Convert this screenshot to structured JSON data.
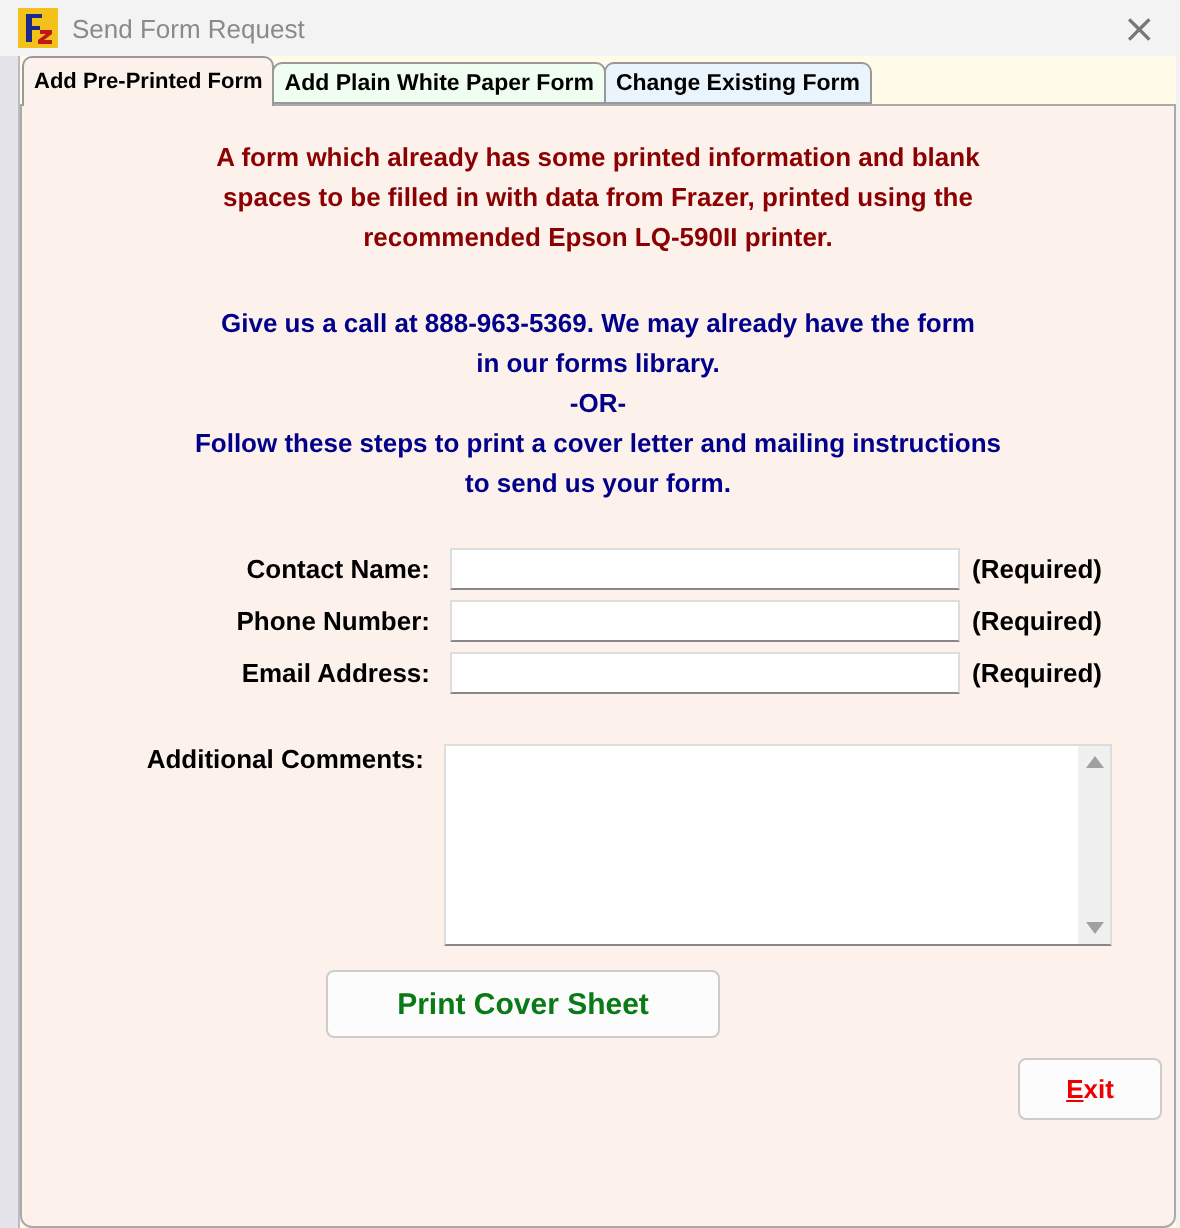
{
  "window": {
    "title": "Send Form Request",
    "close": "×"
  },
  "tabs": [
    {
      "label": "Add Pre-Printed Form",
      "selected": true,
      "color": "#fdf1ec"
    },
    {
      "label": "Add Plain White Paper Form",
      "selected": false,
      "color": "#effef0"
    },
    {
      "label": "Change Existing Form",
      "selected": false,
      "color": "#eaf4fd"
    }
  ],
  "description": [
    "A form which already has some printed information and blank",
    "spaces to be filled in with data from Frazer, printed using the",
    "recommended Epson LQ-590II printer."
  ],
  "instructions": [
    "Give us a call at 888-963-5369. We may already have the form",
    "in our forms library.",
    "-OR-",
    "Follow these steps to print a cover letter and mailing instructions",
    "to send us your form."
  ],
  "fields": [
    {
      "label": "Contact Name:",
      "note": "(Required)"
    },
    {
      "label": "Phone Number:",
      "note": "(Required)"
    },
    {
      "label": "Email Address:",
      "note": "(Required)"
    }
  ],
  "comments": {
    "label": "Additional Comments:"
  },
  "print_button": "Print Cover Sheet",
  "exit_button": {
    "label": "Exit",
    "underline_first": true
  }
}
